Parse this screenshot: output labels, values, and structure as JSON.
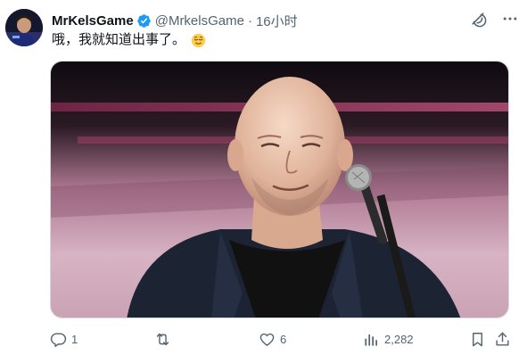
{
  "tweet": {
    "author": {
      "display_name": "MrKelsGame",
      "handle": "@MrkelsGame",
      "separator": "·",
      "time": "16小时",
      "verified_color": "#1d9bf0"
    },
    "text": "哦，我就知道出事了。",
    "emoji": "relieved-face-emoji",
    "media": {
      "description_icon": "photo-bald-man-microphone"
    },
    "actions": {
      "replies": "1",
      "retweets": "",
      "likes": "6",
      "views": "2,282"
    }
  },
  "colors": {
    "text": "#0f1419",
    "secondary": "#536471",
    "accent": "#1d9bf0"
  }
}
